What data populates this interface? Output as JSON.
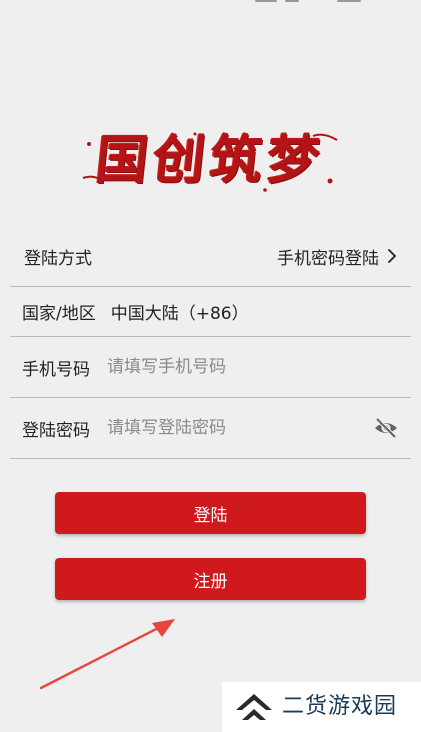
{
  "app": {
    "logo_text": "国创筑梦"
  },
  "form": {
    "login_method": {
      "label": "登陆方式",
      "value": "手机密码登陆"
    },
    "region": {
      "label": "国家/地区",
      "value": "中国大陆（+86）"
    },
    "phone": {
      "label": "手机号码",
      "value": "",
      "placeholder": "请填写手机号码"
    },
    "password": {
      "label": "登陆密码",
      "value": "",
      "placeholder": "请填写登陆密码"
    }
  },
  "buttons": {
    "login_label": "登陆",
    "register_label": "注册"
  },
  "watermark": {
    "text": "二货游戏园"
  },
  "colors": {
    "accent": "#d0191d",
    "logo": "#b31517",
    "background": "#efefef",
    "watermark_text": "#1d3b59"
  },
  "icons": {
    "method_chevron": "chevron-right-icon",
    "password_toggle": "eye-off-icon",
    "annotation": "arrow-icon",
    "watermark_logo": "double-chevron-up-icon"
  }
}
